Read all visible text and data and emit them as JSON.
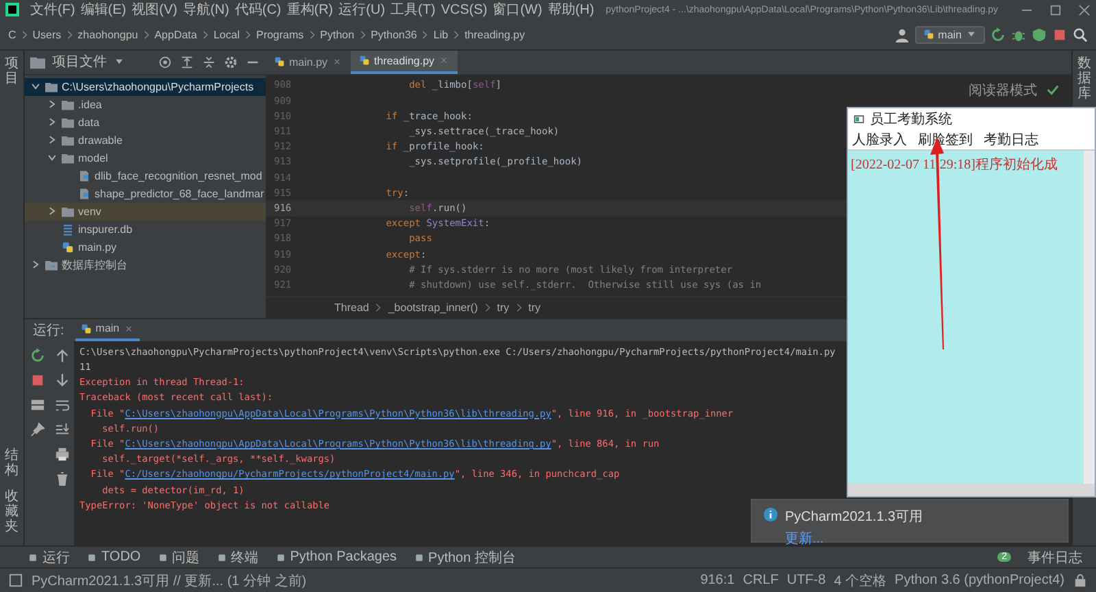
{
  "window": {
    "title": "pythonProject4 - ...\\zhaohongpu\\AppData\\Local\\Programs\\Python\\Python36\\Lib\\threading.py"
  },
  "menu": [
    "文件(F)",
    "编辑(E)",
    "视图(V)",
    "导航(N)",
    "代码(C)",
    "重构(R)",
    "运行(U)",
    "工具(T)",
    "VCS(S)",
    "窗口(W)",
    "帮助(H)"
  ],
  "breadcrumb": [
    "C",
    "Users",
    "zhaohongpu",
    "AppData",
    "Local",
    "Programs",
    "Python",
    "Python36",
    "Lib",
    "threading.py"
  ],
  "run_config": "main",
  "left_strip_top": "项目",
  "left_strip_bottom": [
    "结构",
    "收藏夹"
  ],
  "right_strip": "数据库",
  "project_panel": {
    "title": "项目文件",
    "tree": [
      {
        "label": "C:\\Users\\zhaohongpu\\PycharmProjects",
        "kind": "folder",
        "expanded": true,
        "selected": true,
        "highlighted": false,
        "children": [
          {
            "label": ".idea",
            "kind": "folder",
            "expanded": false,
            "selected": false,
            "highlighted": false
          },
          {
            "label": "data",
            "kind": "folder",
            "expanded": false,
            "selected": false,
            "highlighted": false
          },
          {
            "label": "drawable",
            "kind": "folder",
            "expanded": false,
            "selected": false,
            "highlighted": false
          },
          {
            "label": "model",
            "kind": "folder",
            "expanded": true,
            "selected": false,
            "highlighted": false,
            "children": [
              {
                "label": "dlib_face_recognition_resnet_mod",
                "kind": "model",
                "selected": false,
                "highlighted": false
              },
              {
                "label": "shape_predictor_68_face_landmar",
                "kind": "model",
                "selected": false,
                "highlighted": false
              }
            ]
          },
          {
            "label": "venv",
            "kind": "folder",
            "expanded": false,
            "selected": false,
            "highlighted": true
          },
          {
            "label": "inspurer.db",
            "kind": "db",
            "selected": false,
            "highlighted": false
          },
          {
            "label": "main.py",
            "kind": "python",
            "selected": false,
            "highlighted": false
          }
        ]
      },
      {
        "label": "数据库控制台",
        "kind": "console",
        "expanded": false,
        "selected": false,
        "highlighted": false
      }
    ]
  },
  "editor_tabs": [
    {
      "label": "main.py",
      "selected": false
    },
    {
      "label": "threading.py",
      "selected": true
    }
  ],
  "reader_mode": "阅读器模式",
  "editor": {
    "lines": [
      {
        "number": "908",
        "current": false,
        "tokens": [
          {
            "text": "            del",
            "kind": "keyword"
          },
          {
            "text": " _limbo[",
            "kind": "plain"
          },
          {
            "text": "self",
            "kind": "self"
          },
          {
            "text": "]",
            "kind": "plain"
          }
        ]
      },
      {
        "number": "909",
        "current": false
      },
      {
        "number": "910",
        "current": false,
        "tokens": [
          {
            "text": "        if",
            "kind": "keyword"
          },
          {
            "text": " _trace_hook:",
            "kind": "plain"
          }
        ]
      },
      {
        "number": "911",
        "current": false,
        "tokens": [
          {
            "text": "            _sys.settrace(_trace_hook)",
            "kind": "plain"
          }
        ]
      },
      {
        "number": "912",
        "current": false,
        "tokens": [
          {
            "text": "        if",
            "kind": "keyword"
          },
          {
            "text": " _profile_hook:",
            "kind": "plain"
          }
        ]
      },
      {
        "number": "913",
        "current": false,
        "tokens": [
          {
            "text": "            _sys.setprofile(_profile_hook)",
            "kind": "plain"
          }
        ]
      },
      {
        "number": "914",
        "current": false
      },
      {
        "number": "915",
        "current": false,
        "tokens": [
          {
            "text": "        try",
            "kind": "keyword"
          },
          {
            "text": ":",
            "kind": "plain"
          }
        ]
      },
      {
        "number": "916",
        "current": true,
        "tokens": [
          {
            "text": "            self",
            "kind": "self"
          },
          {
            "text": ".run()",
            "kind": "plain"
          }
        ]
      },
      {
        "number": "917",
        "current": false,
        "tokens": [
          {
            "text": "        except ",
            "kind": "keyword"
          },
          {
            "text": "SystemExit",
            "kind": "builtin"
          },
          {
            "text": ":",
            "kind": "plain"
          }
        ]
      },
      {
        "number": "918",
        "current": false,
        "tokens": [
          {
            "text": "            pass",
            "kind": "keyword"
          }
        ]
      },
      {
        "number": "919",
        "current": false,
        "tokens": [
          {
            "text": "        except",
            "kind": "keyword"
          },
          {
            "text": ":",
            "kind": "plain"
          }
        ]
      },
      {
        "number": "920",
        "current": false,
        "tokens": [
          {
            "text": "            # If sys.stderr is no more (most likely from interpreter",
            "kind": "comment"
          }
        ]
      },
      {
        "number": "921",
        "current": false,
        "tokens": [
          {
            "text": "            # shutdown) use self._stderr.  Otherwise still use sys (as in",
            "kind": "comment"
          }
        ]
      }
    ]
  },
  "editor_breadcrumb": [
    "Thread",
    "_bootstrap_inner()",
    "try",
    "try"
  ],
  "run_panel": {
    "label": "运行:",
    "tab": "main",
    "lines": [
      [
        {
          "text": "C:\\Users\\zhaohongpu\\PycharmProjects\\pythonProject4\\venv\\Scripts\\python.exe C:/Users/zhaohongpu/PycharmProjects/pythonProject4/main.py",
          "kind": "plain"
        }
      ],
      [
        {
          "text": "11",
          "kind": "plain"
        }
      ],
      [
        {
          "text": "Exception in thread Thread-1:",
          "kind": "error"
        }
      ],
      [
        {
          "text": "Traceback (most recent call last):",
          "kind": "error"
        }
      ],
      [
        {
          "text": "  File \"",
          "kind": "error"
        },
        {
          "text": "C:\\Users\\zhaohongpu\\AppData\\Local\\Programs\\Python\\Python36\\lib\\threading.py",
          "kind": "link"
        },
        {
          "text": "\", line 916, in _bootstrap_inner",
          "kind": "error"
        }
      ],
      [
        {
          "text": "    self.run()",
          "kind": "error"
        }
      ],
      [
        {
          "text": "  File \"",
          "kind": "error"
        },
        {
          "text": "C:\\Users\\zhaohongpu\\AppData\\Local\\Programs\\Python\\Python36\\lib\\threading.py",
          "kind": "link"
        },
        {
          "text": "\", line 864, in run",
          "kind": "error"
        }
      ],
      [
        {
          "text": "    self._target(*self._args, **self._kwargs)",
          "kind": "error"
        }
      ],
      [
        {
          "text": "  File \"",
          "kind": "error"
        },
        {
          "text": "C:/Users/zhaohongpu/PycharmProjects/pythonProject4/main.py",
          "kind": "link"
        },
        {
          "text": "\", line 346, in punchcard_cap",
          "kind": "error"
        }
      ],
      [
        {
          "text": "    dets = detector(im_rd, 1)",
          "kind": "error"
        }
      ],
      [
        {
          "text": "TypeError: 'NoneType' object is not callable",
          "kind": "error"
        }
      ]
    ]
  },
  "app_window": {
    "title": "员工考勤系统",
    "menu": [
      "人脸录入",
      "刷脸签到",
      "考勤日志"
    ],
    "log": "[2022-02-07 11:29:18]程序初始化成"
  },
  "notification": {
    "title": "PyCharm2021.1.3可用",
    "action": "更新..."
  },
  "tool_tabs": [
    "运行",
    "TODO",
    "问题",
    "终端",
    "Python Packages",
    "Python 控制台"
  ],
  "event_log": {
    "count": "2",
    "label": "事件日志"
  },
  "status_bar": {
    "message": "PyCharm2021.1.3可用 // 更新... (1 分钟 之前)",
    "items": [
      "916:1",
      "CRLF",
      "UTF-8",
      "4 个空格",
      "Python 3.6 (pythonProject4)"
    ]
  }
}
